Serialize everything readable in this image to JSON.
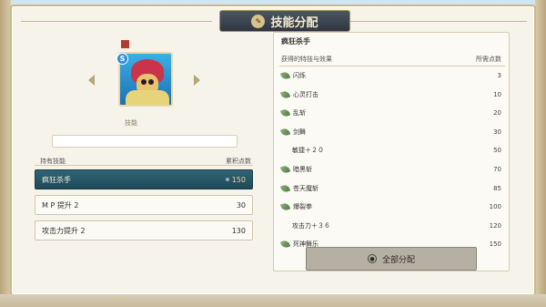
{
  "window": {
    "title": "技能分配"
  },
  "character": {
    "name": "",
    "rank_badge": "S"
  },
  "skills_label": "技能",
  "points": {
    "label": "",
    "value": ""
  },
  "left_list": {
    "header_left": "持有技能",
    "header_right": "累积点数",
    "items": [
      {
        "label": "疯狂杀手",
        "points": "150",
        "active": true
      },
      {
        "label": "M P 提升 2",
        "points": "30",
        "active": false
      },
      {
        "label": "攻击力提升 2",
        "points": "130",
        "active": false
      }
    ]
  },
  "right_panel": {
    "title": "疯狂杀手",
    "header_left": "获得的特技与效果",
    "header_right": "所需点数",
    "rows": [
      {
        "label": "闪烁",
        "cost": "3",
        "leaf": true
      },
      {
        "label": "心灵打击",
        "cost": "10",
        "leaf": true
      },
      {
        "label": "乱斩",
        "cost": "20",
        "leaf": true
      },
      {
        "label": "剑舞",
        "cost": "30",
        "leaf": true
      },
      {
        "label": "敏捷＋２０",
        "cost": "50",
        "leaf": false
      },
      {
        "label": "暗黑斩",
        "cost": "70",
        "leaf": true
      },
      {
        "label": "苍天魔斩",
        "cost": "85",
        "leaf": true
      },
      {
        "label": "爆裂拳",
        "cost": "100",
        "leaf": true
      },
      {
        "label": "攻击力＋３６",
        "cost": "120",
        "leaf": false
      },
      {
        "label": "死神舞乐",
        "cost": "150",
        "leaf": true
      }
    ]
  },
  "allocate_button": {
    "label": "全部分配"
  },
  "colors": {
    "accent": "#2f6474",
    "frame": "#c9b88b",
    "banner": "#3a434f"
  }
}
